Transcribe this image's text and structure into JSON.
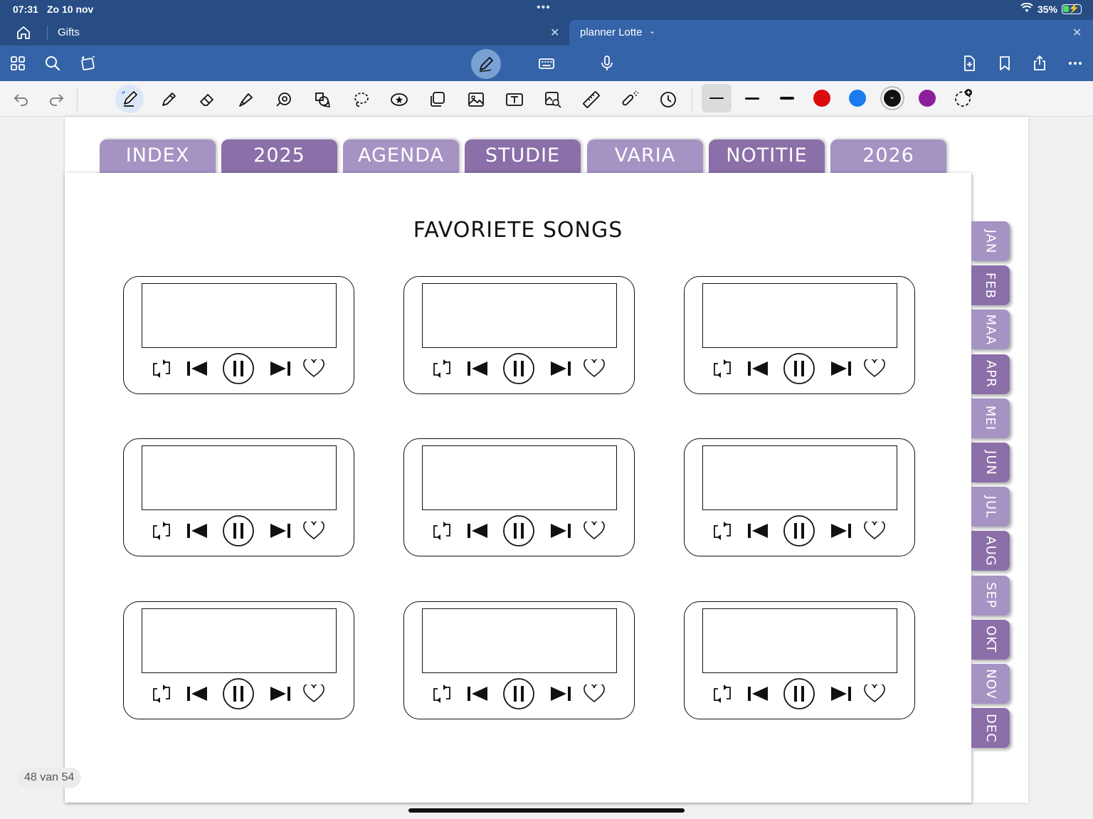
{
  "status": {
    "time": "07:31",
    "date": "Zo 10 nov",
    "battery_text": "35%",
    "battery_level": 0.35
  },
  "tabs": {
    "inactive": {
      "label": "Gifts"
    },
    "active": {
      "label": "planner Lotte"
    }
  },
  "icons": {
    "home": "home-icon",
    "grid": "grid-icon",
    "search": "search-icon",
    "convert": "convert-icon",
    "pen_mode": "pen-mode-icon",
    "keyboard": "keyboard-icon",
    "mic": "microphone-icon",
    "add_page": "add-page-icon",
    "bookmark": "bookmark-icon",
    "share": "share-icon",
    "more": "more-icon"
  },
  "toolbar_tools": [
    "undo-icon",
    "redo-icon",
    "pen-icon",
    "pencil-icon",
    "eraser-icon",
    "highlighter-icon",
    "shape-icon",
    "element-icon",
    "lasso-icon",
    "sticker-icon",
    "copy-icon",
    "image-icon",
    "text-box-icon",
    "camera-icon",
    "ruler-icon",
    "laser-pointer-icon",
    "clock-icon"
  ],
  "colors": {
    "swatches": [
      "#d90b0b",
      "#1a7cf0",
      "#111111",
      "#8b1f9a"
    ],
    "selected_index": 2,
    "tab_light": "#a493c3",
    "tab_dark": "#8a6fa8",
    "chrome_blue": "#3563a8"
  },
  "section_tabs": [
    {
      "label": "INDEX",
      "tone": "light"
    },
    {
      "label": "2025",
      "tone": "dark"
    },
    {
      "label": "AGENDA",
      "tone": "light"
    },
    {
      "label": "STUDIE",
      "tone": "dark"
    },
    {
      "label": "VARIA",
      "tone": "light"
    },
    {
      "label": "NOTITIE",
      "tone": "dark"
    },
    {
      "label": "2026",
      "tone": "light"
    }
  ],
  "month_tabs": [
    {
      "label": "JAN",
      "tone": "light"
    },
    {
      "label": "FEB",
      "tone": "dark"
    },
    {
      "label": "MAA",
      "tone": "light"
    },
    {
      "label": "APR",
      "tone": "dark"
    },
    {
      "label": "MEI",
      "tone": "light"
    },
    {
      "label": "JUN",
      "tone": "dark"
    },
    {
      "label": "JUL",
      "tone": "light"
    },
    {
      "label": "AUG",
      "tone": "dark"
    },
    {
      "label": "SEP",
      "tone": "light"
    },
    {
      "label": "OKT",
      "tone": "dark"
    },
    {
      "label": "NOV",
      "tone": "light"
    },
    {
      "label": "DEC",
      "tone": "dark"
    }
  ],
  "page": {
    "title": "FAVORIETE SONGS",
    "player_controls": [
      "repeat-icon",
      "previous-icon",
      "pause-icon",
      "next-icon",
      "heart-icon"
    ],
    "players": [
      {
        "screen_text": ""
      },
      {
        "screen_text": ""
      },
      {
        "screen_text": ""
      },
      {
        "screen_text": ""
      },
      {
        "screen_text": ""
      },
      {
        "screen_text": ""
      },
      {
        "screen_text": ""
      },
      {
        "screen_text": ""
      },
      {
        "screen_text": ""
      }
    ]
  },
  "page_counter": "48 van 54"
}
